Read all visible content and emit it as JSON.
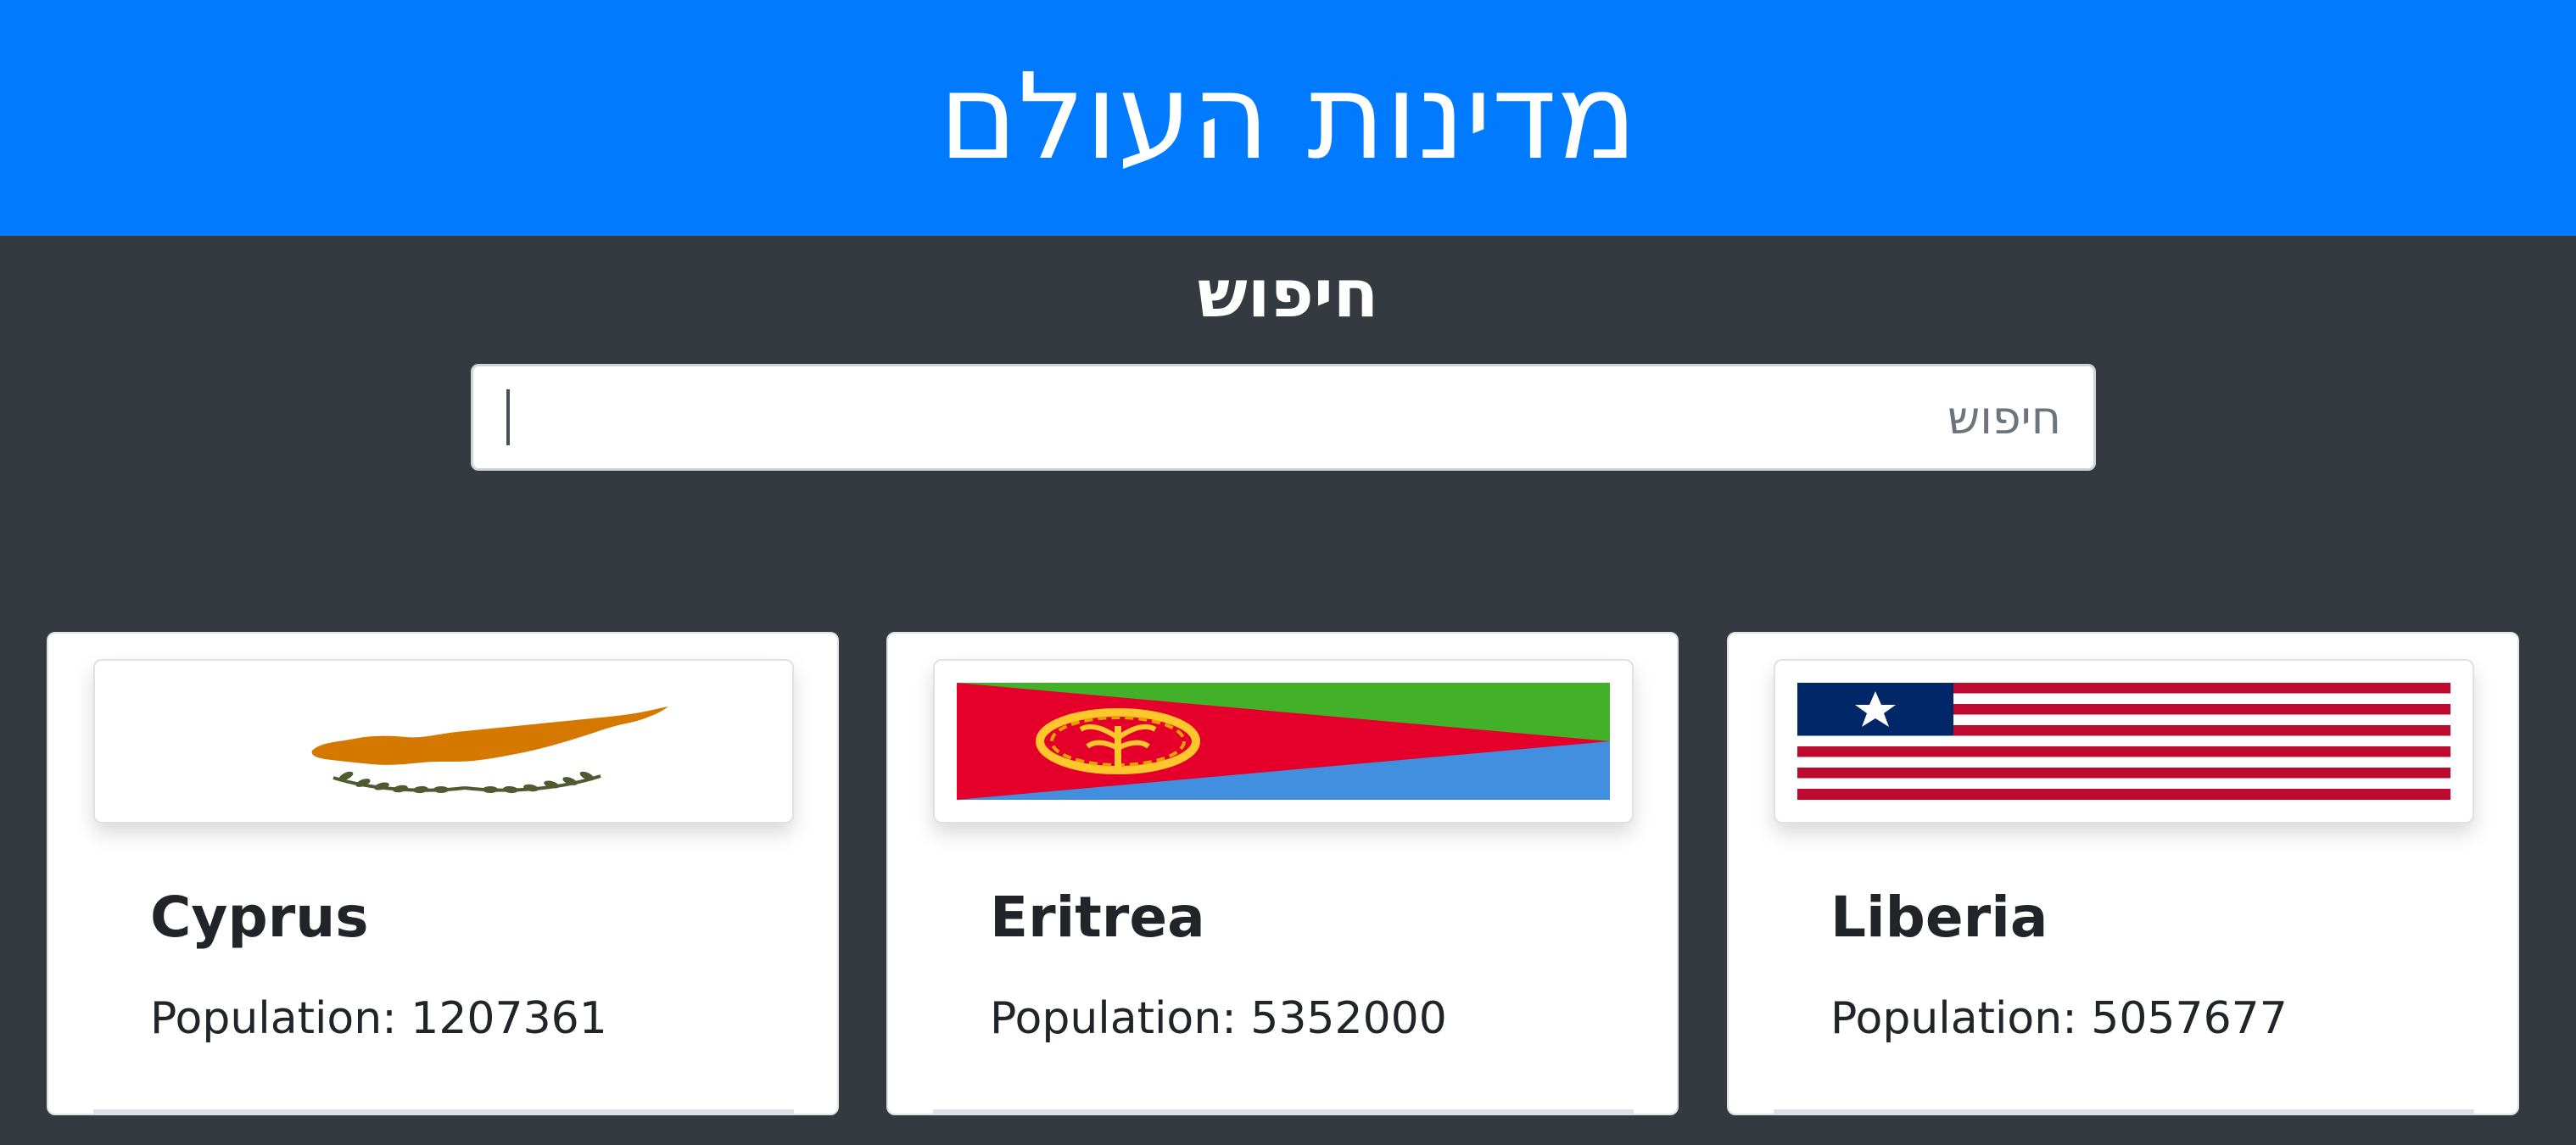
{
  "header": {
    "title": "מדינות העולם"
  },
  "search": {
    "heading": "חיפוש",
    "placeholder": "חיפוש",
    "value": ""
  },
  "countries": [
    {
      "name": "Cyprus",
      "population_text": "Population: 1207361",
      "flag_icon": "cyprus-flag-icon"
    },
    {
      "name": "Eritrea",
      "population_text": "Population: 5352000",
      "flag_icon": "eritrea-flag-icon"
    },
    {
      "name": "Liberia",
      "population_text": "Population: 5057677",
      "flag_icon": "liberia-flag-icon"
    }
  ],
  "colors": {
    "header_bg": "#007bff",
    "page_bg": "#343a40",
    "card_bg": "#ffffff",
    "text": "#212529"
  }
}
